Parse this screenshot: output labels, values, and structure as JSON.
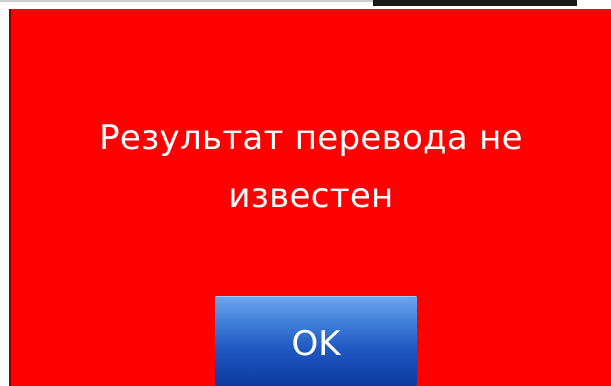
{
  "dialog": {
    "message_line1": "Результат перевода не",
    "message_line2": "известен",
    "ok_label": "OK"
  },
  "colors": {
    "dialog_background": "#ff0000",
    "message_text": "#ffffff",
    "button_top": "#6fa6ee",
    "button_bottom": "#0e3aa0"
  }
}
